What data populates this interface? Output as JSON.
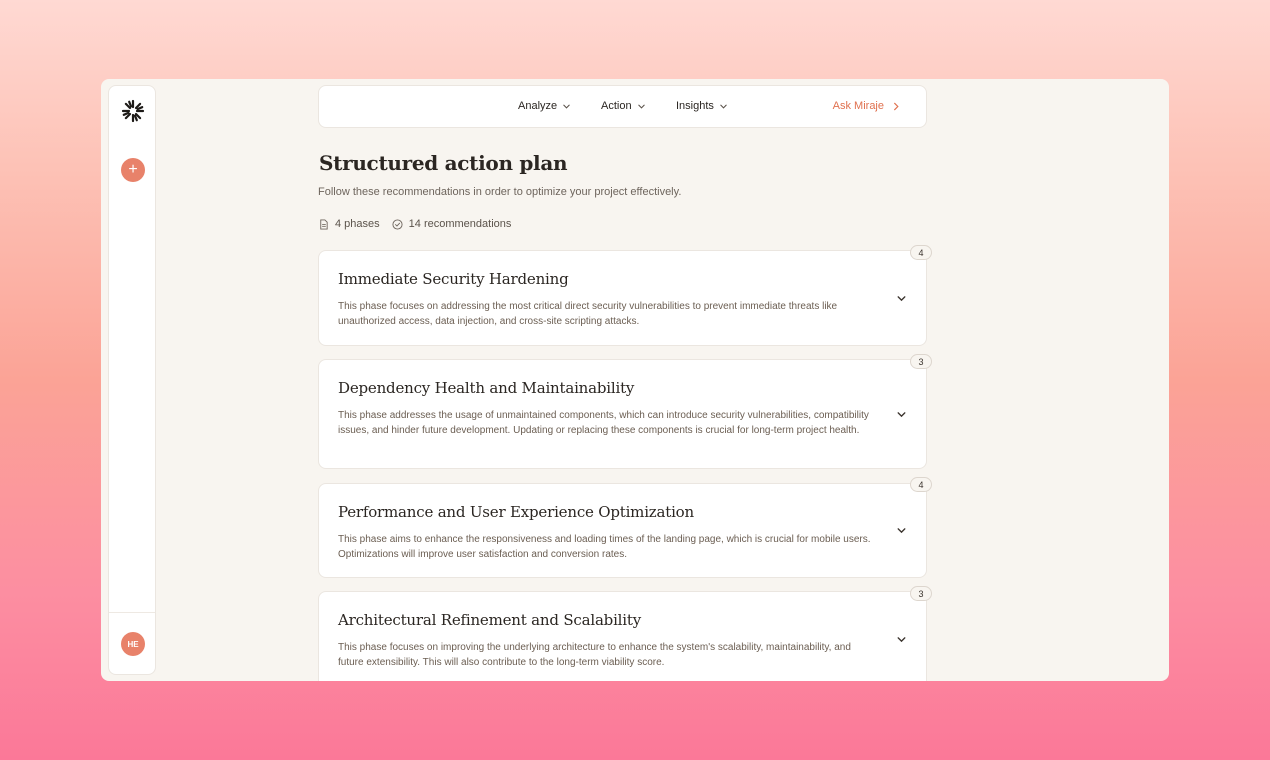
{
  "sidebar": {
    "add_label": "+",
    "avatar_initials": "HE"
  },
  "nav": {
    "items": [
      {
        "label": "Analyze"
      },
      {
        "label": "Action"
      },
      {
        "label": "Insights"
      }
    ],
    "ask_label": "Ask Miraje"
  },
  "page": {
    "title": "Structured action plan",
    "subtitle": "Follow these recommendations in order to optimize your project effectively.",
    "phases_count": "4 phases",
    "recommendations_count": "14 recommendations"
  },
  "phases": [
    {
      "title": "Immediate Security Hardening",
      "description": "This phase focuses on addressing the most critical direct security vulnerabilities to prevent immediate threats like unauthorized access, data injection, and cross-site scripting attacks.",
      "count": "4"
    },
    {
      "title": "Dependency Health and Maintainability",
      "description": "This phase addresses the usage of unmaintained components, which can introduce security vulnerabilities, compatibility issues, and hinder future development. Updating or replacing these components is crucial for long-term project health.",
      "count": "3"
    },
    {
      "title": "Performance and User Experience Optimization",
      "description": "This phase aims to enhance the responsiveness and loading times of the landing page, which is crucial for mobile users. Optimizations will improve user satisfaction and conversion rates.",
      "count": "4"
    },
    {
      "title": "Architectural Refinement and Scalability",
      "description": "This phase focuses on improving the underlying architecture to enhance the system's scalability, maintainability, and future extensibility. This will also contribute to the long-term viability score.",
      "count": "3"
    }
  ],
  "colors": {
    "accent": "#e8826a",
    "link": "#e0714f",
    "background": "#f8f5f0"
  }
}
